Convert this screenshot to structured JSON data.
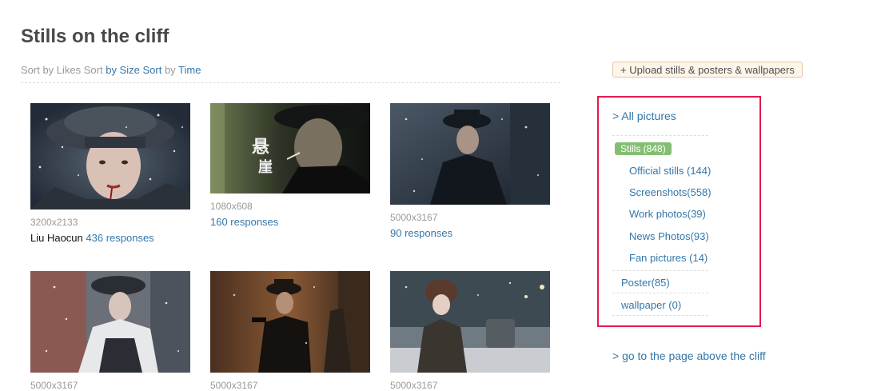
{
  "page": {
    "title": "Stills on the cliff"
  },
  "sort": {
    "text1": "Sort by Likes Sort ",
    "size_label": "by Size",
    "text2": " ",
    "sort2": "Sort",
    "text3": " by ",
    "time_label": "Time"
  },
  "photos": [
    {
      "size": "3200x2133",
      "name": "Liu Haocun ",
      "responses": "436 responses"
    },
    {
      "size": "1080x608",
      "name": "",
      "responses": "160 responses"
    },
    {
      "size": "5000x3167",
      "name": "",
      "responses": "90 responses"
    },
    {
      "size": "5000x3167",
      "name": "",
      "responses": ""
    },
    {
      "size": "5000x3167",
      "name": "",
      "responses": ""
    },
    {
      "size": "5000x3167",
      "name": "",
      "responses": ""
    }
  ],
  "upload_button": "+ Upload stills & posters & wallpapers",
  "categories": {
    "all": "> All pictures",
    "stills": "Stills (848)",
    "subs": [
      "Official stills (144)",
      "Screenshots(558)",
      "Work photos(39)",
      "News Photos(93)",
      "Fan pictures (14)"
    ],
    "poster": "Poster(85)",
    "wallpaper": "wallpaper (0)"
  },
  "go_up": "> go to the page above the cliff",
  "colors": {
    "link": "#3377aa",
    "highlight_border": "#e31a4c",
    "badge": "#83bf73"
  }
}
